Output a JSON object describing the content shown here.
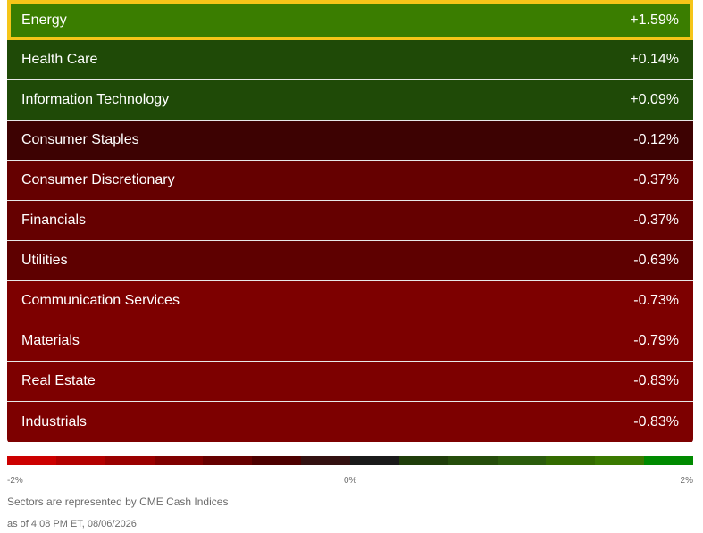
{
  "sectors": [
    {
      "name": "Energy",
      "change": "+1.59%",
      "color": "#3a7d00",
      "highlighted": true
    },
    {
      "name": "Health Care",
      "change": "+0.14%",
      "color": "#1f4a07",
      "highlighted": false
    },
    {
      "name": "Information Technology",
      "change": "+0.09%",
      "color": "#1f4a07",
      "highlighted": false
    },
    {
      "name": "Consumer Staples",
      "change": "-0.12%",
      "color": "#3d0202",
      "highlighted": false
    },
    {
      "name": "Consumer Discretionary",
      "change": "-0.37%",
      "color": "#650000",
      "highlighted": false
    },
    {
      "name": "Financials",
      "change": "-0.37%",
      "color": "#650000",
      "highlighted": false
    },
    {
      "name": "Utilities",
      "change": "-0.63%",
      "color": "#5e0000",
      "highlighted": false
    },
    {
      "name": "Communication Services",
      "change": "-0.73%",
      "color": "#7d0000",
      "highlighted": false
    },
    {
      "name": "Materials",
      "change": "-0.79%",
      "color": "#7d0000",
      "highlighted": false
    },
    {
      "name": "Real Estate",
      "change": "-0.83%",
      "color": "#7d0000",
      "highlighted": false
    },
    {
      "name": "Industrials",
      "change": "-0.83%",
      "color": "#7d0000",
      "highlighted": false
    }
  ],
  "highlight_color": "#f5c518",
  "scale": {
    "min_label": "-2%",
    "mid_label": "0%",
    "max_label": "2%",
    "colors": [
      "#cc0000",
      "#b30000",
      "#9a0000",
      "#800000",
      "#660000",
      "#4d0000",
      "#331111",
      "#1a1a1a",
      "#1f3d0a",
      "#254d0b",
      "#2b5c0c",
      "#336b00",
      "#3a7a00",
      "#008a00"
    ]
  },
  "footnote": "Sectors are represented by CME Cash Indices",
  "timestamp": "as of 4:08 PM ET, 08/06/2026"
}
